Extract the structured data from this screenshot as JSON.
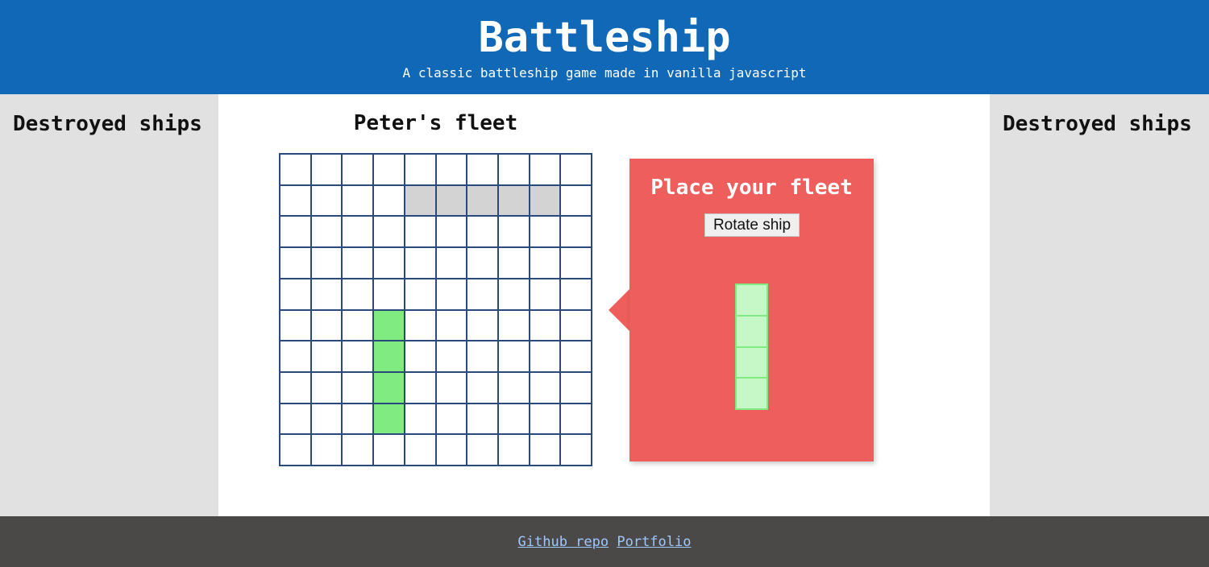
{
  "header": {
    "title": "Battleship",
    "subtitle": "A classic battleship game made in vanilla javascript"
  },
  "sidebars": {
    "left_heading": "Destroyed ships",
    "right_heading": "Destroyed ships"
  },
  "fleet": {
    "title": "Peter's fleet",
    "grid": {
      "rows": 10,
      "cols": 10
    },
    "preview_cells": [
      [
        1,
        4
      ],
      [
        1,
        5
      ],
      [
        1,
        6
      ],
      [
        1,
        7
      ],
      [
        1,
        8
      ]
    ],
    "placed_ship_cells": [
      [
        5,
        3
      ],
      [
        6,
        3
      ],
      [
        7,
        3
      ],
      [
        8,
        3
      ]
    ]
  },
  "popup": {
    "title": "Place your fleet",
    "rotate_label": "Rotate ship",
    "current_ship_length": 4,
    "current_ship_orientation": "vertical"
  },
  "footer": {
    "github_label": "Github repo",
    "portfolio_label": "Portfolio"
  },
  "colors": {
    "header_bg": "#1068b6",
    "sidebar_bg": "#e1e1e1",
    "grid_line": "#2a4a7e",
    "preview_cell": "#d3d3d3",
    "ship_cell": "#80eb80",
    "popup_bg": "#ee5e5c",
    "footer_bg": "#4b4948",
    "link": "#9ec7ff"
  }
}
